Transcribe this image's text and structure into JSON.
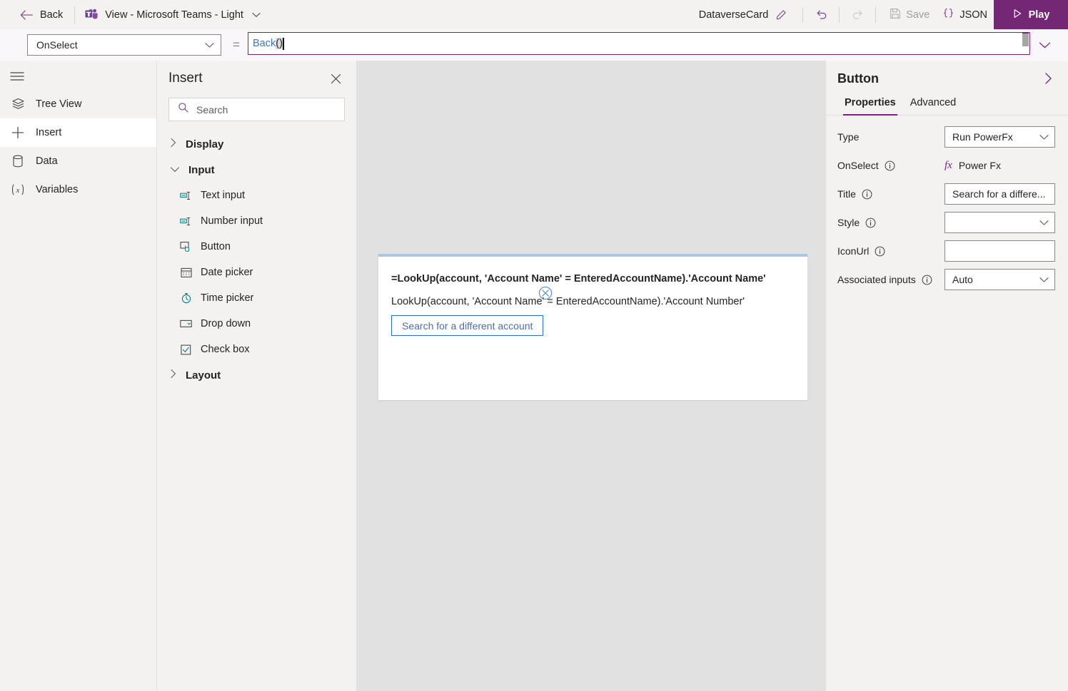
{
  "header": {
    "back_label": "Back",
    "back_icon": "arrow-left-icon",
    "doc_title": "View - Microsoft Teams - Light",
    "doc_icon": "microsoft-teams-icon",
    "doc_chevron_icon": "chevron-down-icon",
    "card_name": "DataverseCard",
    "edit_icon": "pencil-icon",
    "undo_icon": "undo-icon",
    "redo_icon": "redo-icon",
    "save_label": "Save",
    "save_icon": "save-disk-icon",
    "json_label": "JSON",
    "json_icon": "curly-braces-icon",
    "play_label": "Play",
    "play_icon": "play-triangle-icon",
    "accent_color": "#742774"
  },
  "formula_bar": {
    "property": "OnSelect",
    "property_chevron_icon": "chevron-down-icon",
    "equals": "=",
    "formula_function": "Back",
    "formula_parens": "()",
    "expand_icon": "chevron-down-icon",
    "border_color": "#742774"
  },
  "rail": {
    "menu_icon": "hamburger-menu-icon",
    "items": [
      {
        "label": "Tree View",
        "icon": "layers-icon",
        "active": false
      },
      {
        "label": "Insert",
        "icon": "plus-icon",
        "active": true
      },
      {
        "label": "Data",
        "icon": "database-icon",
        "active": false
      },
      {
        "label": "Variables",
        "icon": "variable-x-icon",
        "active": false
      }
    ]
  },
  "insert_panel": {
    "title": "Insert",
    "close_icon": "close-icon",
    "search_placeholder": "Search",
    "search_value": "",
    "search_icon": "search-icon",
    "groups": [
      {
        "label": "Display",
        "expanded": false,
        "chevron_icon": "chevron-right-icon",
        "items": []
      },
      {
        "label": "Input",
        "expanded": true,
        "chevron_icon": "chevron-down-icon",
        "items": [
          {
            "label": "Text input",
            "icon": "text-input-icon"
          },
          {
            "label": "Number input",
            "icon": "number-input-icon"
          },
          {
            "label": "Button",
            "icon": "button-icon"
          },
          {
            "label": "Date picker",
            "icon": "calendar-icon"
          },
          {
            "label": "Time picker",
            "icon": "clock-icon"
          },
          {
            "label": "Drop down",
            "icon": "dropdown-icon"
          },
          {
            "label": "Check box",
            "icon": "checkbox-icon"
          }
        ]
      },
      {
        "label": "Layout",
        "expanded": false,
        "chevron_icon": "chevron-right-icon",
        "items": []
      }
    ]
  },
  "canvas": {
    "background_color": "#e1e1e1",
    "card": {
      "accent_color": "#a8c6e8",
      "line1": "=LookUp(account, 'Account Name' = EnteredAccountName).'Account Name'",
      "line2": "LookUp(account, 'Account Name' = EnteredAccountName).'Account Number'",
      "button_label": "Search for a different account",
      "button_border_color": "#2a6fc9",
      "cursor_icon": "circle-x-cursor-icon"
    }
  },
  "properties_panel": {
    "title": "Button",
    "collapse_icon": "chevron-right-icon",
    "tabs": [
      {
        "label": "Properties",
        "active": true
      },
      {
        "label": "Advanced",
        "active": false
      }
    ],
    "rows": [
      {
        "label": "Type",
        "has_info": false,
        "control": "dropdown",
        "value": "Run PowerFx",
        "chevron_icon": "chevron-down-icon"
      },
      {
        "label": "OnSelect",
        "has_info": true,
        "control": "fx",
        "value": "Power Fx",
        "fx_icon": "fx-icon"
      },
      {
        "label": "Title",
        "has_info": true,
        "control": "text",
        "value": "Search for a differe..."
      },
      {
        "label": "Style",
        "has_info": true,
        "control": "dropdown",
        "value": "",
        "chevron_icon": "chevron-down-icon"
      },
      {
        "label": "IconUrl",
        "has_info": true,
        "control": "text",
        "value": ""
      },
      {
        "label": "Associated inputs",
        "has_info": true,
        "control": "dropdown",
        "value": "Auto",
        "chevron_icon": "chevron-down-icon"
      }
    ]
  }
}
